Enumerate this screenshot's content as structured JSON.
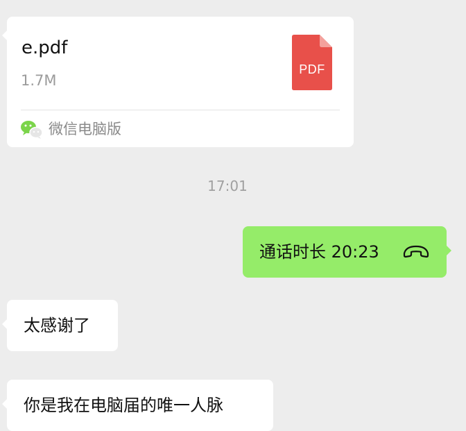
{
  "file_message": {
    "file_name": "e.pdf",
    "file_size": "1.7M",
    "file_type_label": "PDF",
    "file_icon": "pdf-file-icon",
    "source_icon": "wechat-icon",
    "source_label": "微信电脑版",
    "colors": {
      "pdf_icon": "#e8504a",
      "pdf_fold": "#f4a19c"
    }
  },
  "timestamp": "17:01",
  "call_message": {
    "text": "通话时长 20:23",
    "icon": "phone-hangup-icon",
    "bubble_color": "#95ec69"
  },
  "messages": [
    {
      "text": "太感谢了"
    },
    {
      "text": "你是我在电脑届的唯一人脉"
    }
  ],
  "colors": {
    "background": "#ededed",
    "incoming_bubble": "#ffffff",
    "outgoing_bubble": "#95ec69"
  }
}
